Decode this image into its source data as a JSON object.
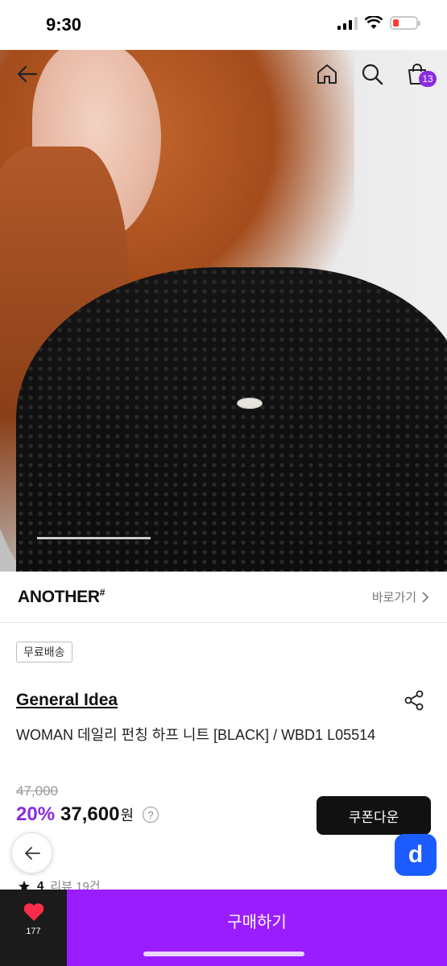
{
  "status_bar": {
    "time": "9:30"
  },
  "header": {
    "cart_count": "13"
  },
  "hero": {
    "slide_progress": 0.12
  },
  "brand": {
    "logo_text": "ANOTHER",
    "logo_mark": "#",
    "link_label": "바로가기"
  },
  "product": {
    "tag": "무료배송",
    "brand_name": "General Idea",
    "name": "WOMAN 데일리 펀칭 하프 니트 [BLACK] / WBD1 L05514",
    "original_price": "47,000",
    "discount_rate": "20%",
    "sale_price": "37,600",
    "price_unit": "원",
    "coupon_button": "쿠폰다운",
    "rating": "4",
    "reviews": "리뷰 19건"
  },
  "floating": {
    "app_label": "d"
  },
  "bottom_bar": {
    "like_count": "177",
    "buy_label": "구매하기"
  },
  "colors": {
    "accent": "#9a1dff",
    "discount": "#8a2be2",
    "app_button": "#1a5cff"
  },
  "icons": [
    "back-arrow-icon",
    "home-icon",
    "search-icon",
    "shopping-bag-icon",
    "chevron-right-icon",
    "share-icon",
    "question-icon",
    "star-icon",
    "heart-icon"
  ]
}
